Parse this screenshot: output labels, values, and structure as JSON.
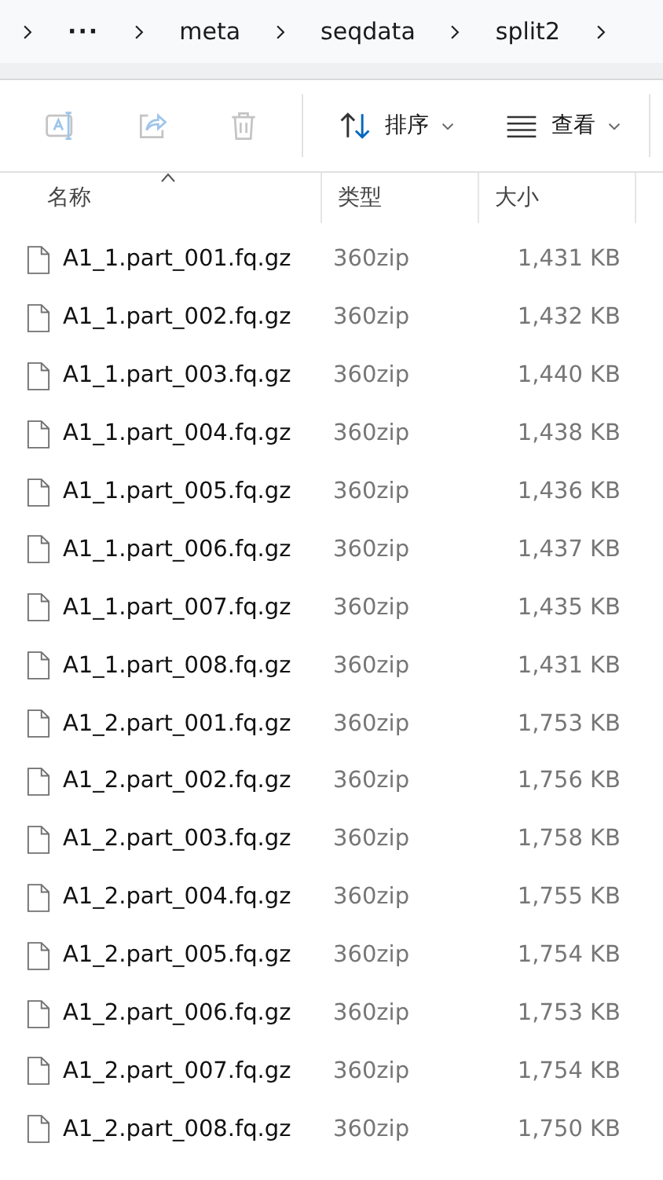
{
  "breadcrumb": {
    "overflow": "···",
    "items": [
      "meta",
      "seqdata",
      "split2"
    ]
  },
  "toolbar": {
    "actions": [
      {
        "kind": "rename",
        "disabled": true
      },
      {
        "kind": "share",
        "disabled": true
      },
      {
        "kind": "delete",
        "disabled": true
      }
    ],
    "sort": {
      "label": "排序"
    },
    "view": {
      "label": "查看"
    }
  },
  "table": {
    "columns": [
      {
        "label": "名称",
        "sorted": true
      },
      {
        "label": "类型",
        "sorted": false
      },
      {
        "label": "大小",
        "sorted": false
      }
    ],
    "rows": [
      {
        "name": "A1_1.part_001.fq.gz",
        "type": "360zip",
        "size": "1,431 KB"
      },
      {
        "name": "A1_1.part_002.fq.gz",
        "type": "360zip",
        "size": "1,432 KB"
      },
      {
        "name": "A1_1.part_003.fq.gz",
        "type": "360zip",
        "size": "1,440 KB"
      },
      {
        "name": "A1_1.part_004.fq.gz",
        "type": "360zip",
        "size": "1,438 KB"
      },
      {
        "name": "A1_1.part_005.fq.gz",
        "type": "360zip",
        "size": "1,436 KB"
      },
      {
        "name": "A1_1.part_006.fq.gz",
        "type": "360zip",
        "size": "1,437 KB"
      },
      {
        "name": "A1_1.part_007.fq.gz",
        "type": "360zip",
        "size": "1,435 KB"
      },
      {
        "name": "A1_1.part_008.fq.gz",
        "type": "360zip",
        "size": "1,431 KB"
      },
      {
        "name": "A1_2.part_001.fq.gz",
        "type": "360zip",
        "size": "1,753 KB"
      },
      {
        "name": "A1_2.part_002.fq.gz",
        "type": "360zip",
        "size": "1,756 KB"
      },
      {
        "name": "A1_2.part_003.fq.gz",
        "type": "360zip",
        "size": "1,758 KB"
      },
      {
        "name": "A1_2.part_004.fq.gz",
        "type": "360zip",
        "size": "1,755 KB"
      },
      {
        "name": "A1_2.part_005.fq.gz",
        "type": "360zip",
        "size": "1,754 KB"
      },
      {
        "name": "A1_2.part_006.fq.gz",
        "type": "360zip",
        "size": "1,753 KB"
      },
      {
        "name": "A1_2.part_007.fq.gz",
        "type": "360zip",
        "size": "1,754 KB"
      },
      {
        "name": "A1_2.part_008.fq.gz",
        "type": "360zip",
        "size": "1,750 KB"
      }
    ]
  }
}
